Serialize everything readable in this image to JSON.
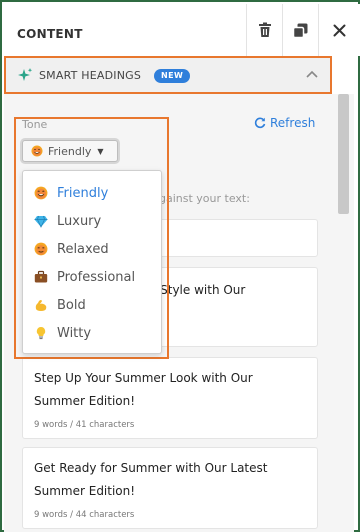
{
  "header": {
    "title": "CONTENT",
    "icons": [
      "trash-icon",
      "copy-icon",
      "close-icon"
    ]
  },
  "smart_headings": {
    "label": "SMART HEADINGS",
    "badge": "NEW",
    "icon": "sparkle-icon",
    "collapse_icon": "chevron-up-icon",
    "accent_color": "#e8772e",
    "badge_color": "#2f7fdb"
  },
  "tone": {
    "label": "Tone",
    "selected": "Friendly",
    "refresh_label": "Refresh",
    "options": [
      {
        "label": "Friendly",
        "icon": "smile-face-icon"
      },
      {
        "label": "Luxury",
        "icon": "diamond-icon"
      },
      {
        "label": "Relaxed",
        "icon": "relaxed-face-icon"
      },
      {
        "label": "Professional",
        "icon": "briefcase-icon"
      },
      {
        "label": "Bold",
        "icon": "flexed-arm-icon"
      },
      {
        "label": "Witty",
        "icon": "lightbulb-icon"
      }
    ]
  },
  "hint_text": "gainst your text:",
  "suggestions": [
    {
      "line1": "",
      "line2": "",
      "meta": ""
    },
    {
      "line1": "er Style with Our",
      "line2": "",
      "meta": ""
    },
    {
      "line1": "Step Up Your Summer Look with Our",
      "line2": "Summer Edition!",
      "meta": "9 words / 41 characters"
    },
    {
      "line1": "Get Ready for Summer with Our Latest",
      "line2": "Summer Edition!",
      "meta": "9 words / 44 characters"
    }
  ]
}
